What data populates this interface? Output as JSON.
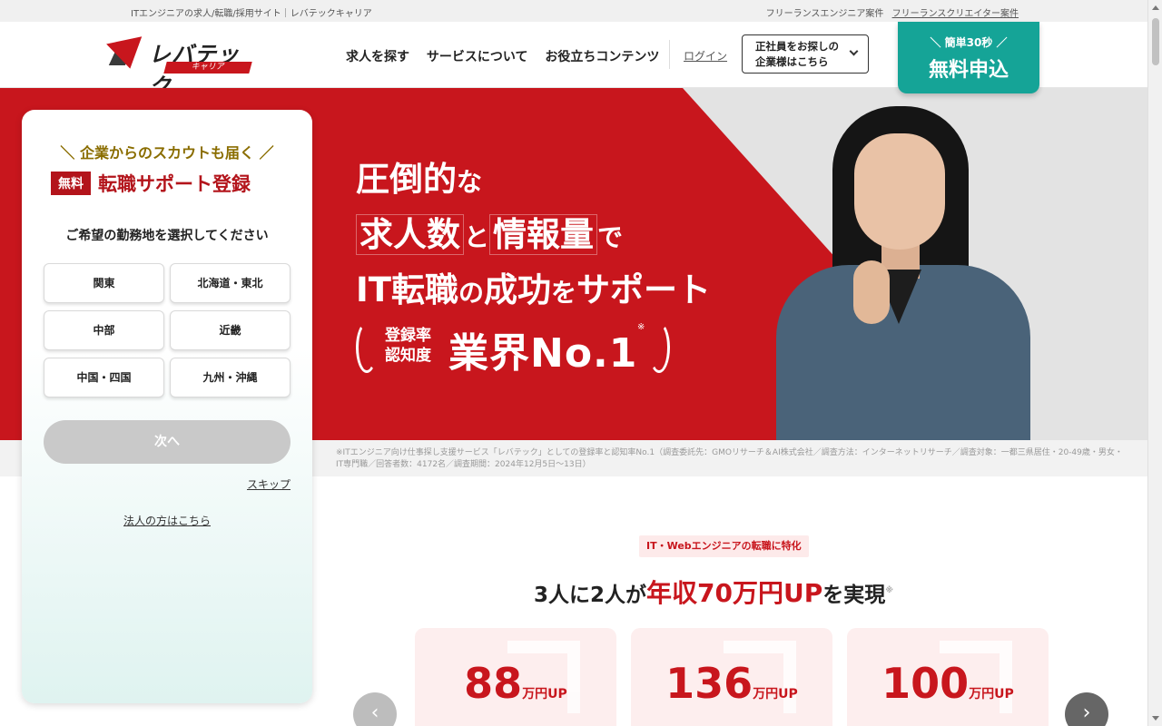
{
  "utilbar": {
    "left_text": "ITエンジニアの求人/転職/採用サイト｜レバテックキャリア",
    "freelance_engineer": "フリーランスエンジニア案件",
    "freelance_creator": "フリーランスクリエイター案件"
  },
  "header": {
    "logo_name": "レバテック",
    "logo_sub": "キャリア",
    "nav": [
      "求人を探す",
      "サービスについて",
      "お役立ちコンテンツ"
    ],
    "login": "ログイン",
    "corp_btn_line1": "正社員をお探しの",
    "corp_btn_line2": "企業様はこちら",
    "apply_small": "＼ 簡単30秒 ／",
    "apply_big": "無料申込"
  },
  "hero": {
    "line1_a": "圧倒的",
    "line1_b": "な",
    "line2_a": "求人数",
    "line2_b": "と",
    "line2_c": "情報量",
    "line2_d": "で",
    "line3_a": "IT転職",
    "line3_b": "の",
    "line3_c": "成功",
    "line3_d": "を",
    "line3_e": "サポート",
    "badge_label1": "登録率",
    "badge_label2": "認知度",
    "badge_main": "業界No.1",
    "badge_mark": "※"
  },
  "footnote": "※ITエンジニア向け仕事探し支援サービス「レバテック」としての登録率と認知率No.1（調査委託先：GMOリサーチ＆AI株式会社／調査方法：インターネットリサーチ／調査対象：一都三県居住・20-49歳・男女・IT専門職／回答者数：4172名／調査期間：2024年12月5日〜13日）",
  "form": {
    "scout": "＼ 企業からのスカウトも届く ／",
    "free_tag": "無料",
    "title": "転職サポート登録",
    "ask": "ご希望の勤務地を選択してください",
    "regions": [
      "関東",
      "北海道・東北",
      "中部",
      "近畿",
      "中国・四国",
      "九州・沖縄"
    ],
    "next": "次へ",
    "skip": "スキップ",
    "corp_link": "法人の方はこちら"
  },
  "section": {
    "pill": "IT・Webエンジニアの転職に特化",
    "lead_a": "3人に2人が",
    "lead_b": "年収70万円UP",
    "lead_c": "を実現",
    "lead_mark": "※",
    "stats": [
      {
        "num": "88",
        "unit": "万円UP"
      },
      {
        "num": "136",
        "unit": "万円UP"
      },
      {
        "num": "100",
        "unit": "万円UP"
      }
    ],
    "prev_icon": "chevron-left-icon",
    "next_icon": "chevron-right-icon"
  },
  "colors": {
    "brand_red": "#c8161d",
    "teal": "#15a497",
    "gold": "#8a6d00"
  }
}
